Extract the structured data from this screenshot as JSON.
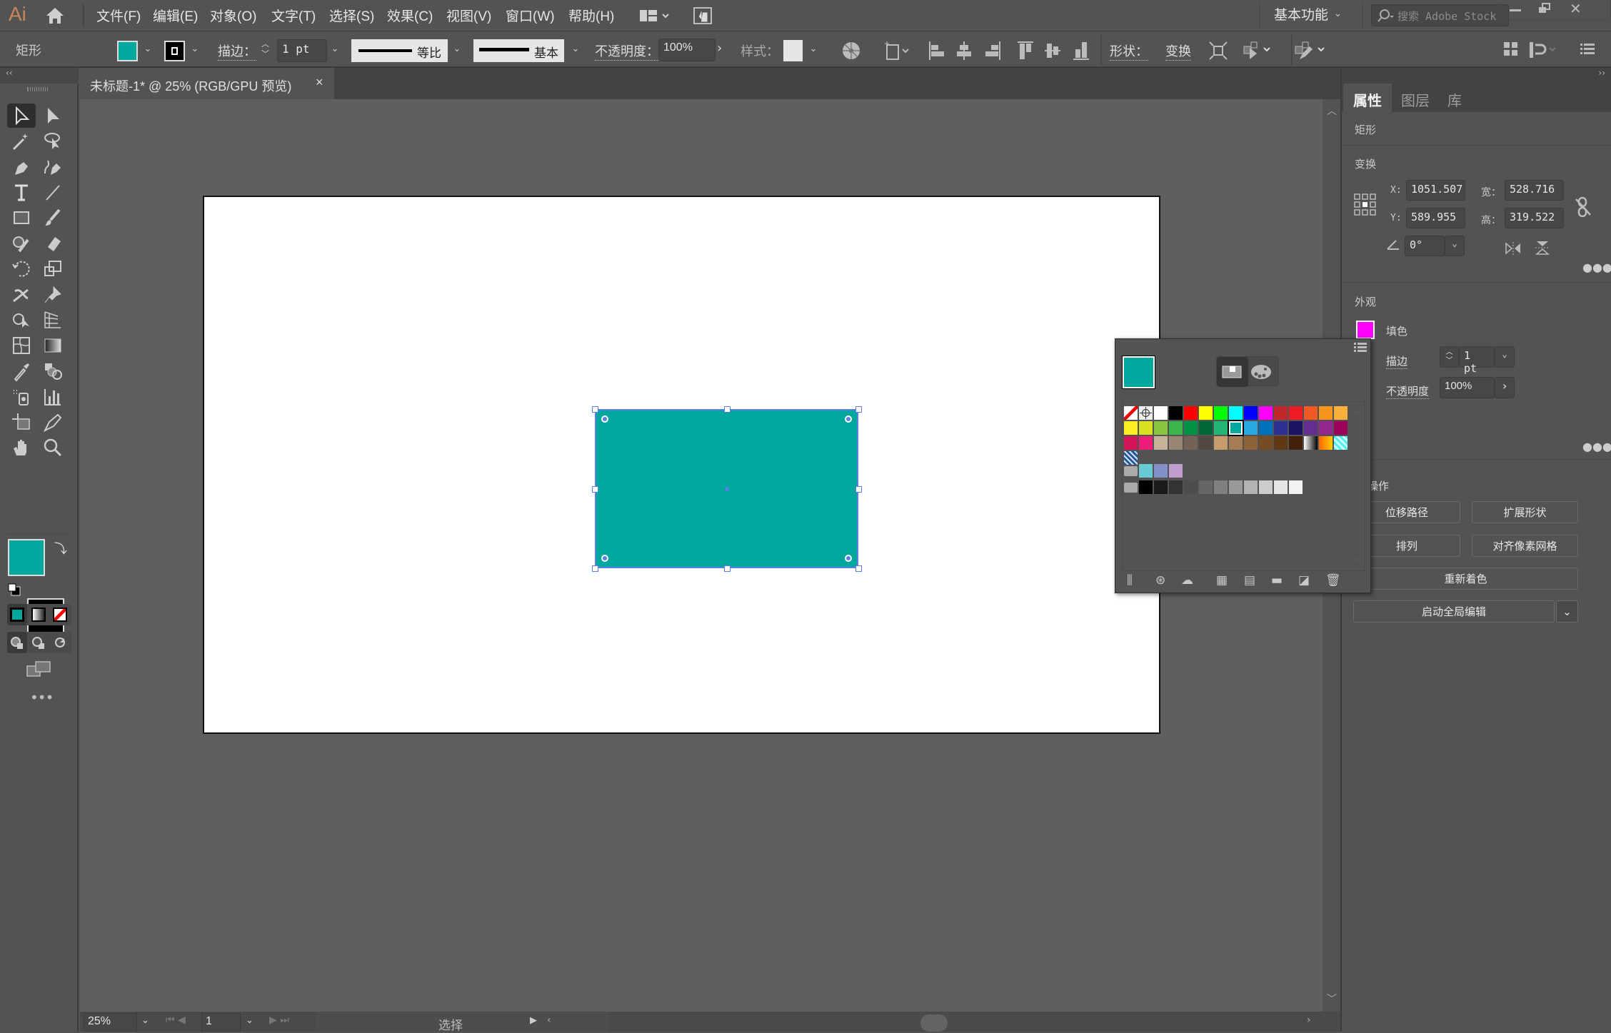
{
  "app": {
    "logo": "Ai"
  },
  "menu": [
    "文件(F)",
    "编辑(E)",
    "对象(O)",
    "文字(T)",
    "选择(S)",
    "效果(C)",
    "视图(V)",
    "窗口(W)",
    "帮助(H)"
  ],
  "workspace": {
    "label": "基本功能",
    "search_placeholder": "搜索 Adobe Stock"
  },
  "control_bar": {
    "object_type": "矩形",
    "fill_color": "#00a79d",
    "stroke_label": "描边：",
    "stroke_weight": "1 pt",
    "stroke_profile": "等比",
    "brush": "基本",
    "opacity_label": "不透明度：",
    "opacity": "100%",
    "style_label": "样式：",
    "shape_label": "形状：",
    "transform_label": "变换"
  },
  "document": {
    "tab_title": "未标题-1* @ 25% (RGB/GPU 预览)",
    "close": "×"
  },
  "status": {
    "zoom": "25%",
    "artboard": "1",
    "tool": "选择"
  },
  "tools": [
    [
      "selection-tool",
      "direct-selection-tool"
    ],
    [
      "magic-wand-tool",
      "lasso-tool"
    ],
    [
      "pen-tool",
      "curvature-tool"
    ],
    [
      "type-tool",
      "line-tool"
    ],
    [
      "rectangle-tool",
      "paintbrush-tool"
    ],
    [
      "shaper-tool",
      "eraser-tool"
    ],
    [
      "rotate-tool",
      "scale-tool"
    ],
    [
      "warp-tool",
      "pin-tool"
    ],
    [
      "shape-builder-tool",
      "perspective-grid-tool"
    ],
    [
      "mesh-tool",
      "gradient-tool"
    ],
    [
      "eyedropper-tool",
      "blend-tool"
    ],
    [
      "symbol-sprayer-tool",
      "column-graph-tool"
    ],
    [
      "artboard-tool",
      "slice-tool"
    ],
    [
      "hand-tool",
      "zoom-tool"
    ]
  ],
  "colors": {
    "fill": "#00a79d",
    "stroke": "#000000",
    "accent": "#5b7fe8",
    "appearance_fill": "#ff00ff"
  },
  "properties": {
    "tabs": [
      "属性",
      "图层",
      "库"
    ],
    "object_type": "矩形",
    "transform_title": "变换",
    "x_label": "X:",
    "x": "1051.507",
    "y_label": "Y:",
    "y": "589.955",
    "w_label": "宽：",
    "w": "528.716",
    "h_label": "高：",
    "h": "319.522",
    "angle": "0°",
    "appearance_title": "外观",
    "fill_label": "填色",
    "stroke_label": "描边",
    "stroke_weight": "1 pt",
    "opacity_label": "不透明度",
    "opacity": "100%",
    "quick_actions_title": "操作",
    "buttons": [
      "位移路径",
      "扩展形状",
      "排列",
      "对齐像素网格",
      "重新着色",
      "启动全局编辑"
    ]
  },
  "swatches": {
    "current": "#00a79d",
    "rows": [
      [
        "none",
        "registration",
        "#ffffff",
        "#000000",
        "#ff0000",
        "#ffff00",
        "#00ff00",
        "#00ffff",
        "#0000ff",
        "#ff00ff",
        "#c1272d",
        "#ed1c24",
        "#f15a24",
        "#f7931e",
        "#fbb03b"
      ],
      [
        "#fcee21",
        "#d9e021",
        "#8cc63f",
        "#39b54a",
        "#009245",
        "#006837",
        "#22b573",
        "#00a99d",
        "#29abe2",
        "#0071bc",
        "#2e3192",
        "#1b1464",
        "#662d91",
        "#93278f",
        "#9e005d"
      ],
      [
        "#d4145a",
        "#ed1e79",
        "#c7b299",
        "#998675",
        "#736357",
        "#534741",
        "#c69c6d",
        "#a67c52",
        "#8c6239",
        "#754c24",
        "#603813",
        "#42210b",
        "gradient-bw",
        "gradient-orange",
        "pattern-cyan"
      ],
      [
        "pattern-blue"
      ]
    ],
    "group1": [
      "#6acad4",
      "#8490c8",
      "#c09dcc"
    ],
    "group2": [
      "#000000",
      "#1a1a1a",
      "#333333",
      "#4d4d4d",
      "#666666",
      "#808080",
      "#999999",
      "#b3b3b3",
      "#cccccc",
      "#e6e6e6",
      "#f2f2f2"
    ]
  }
}
